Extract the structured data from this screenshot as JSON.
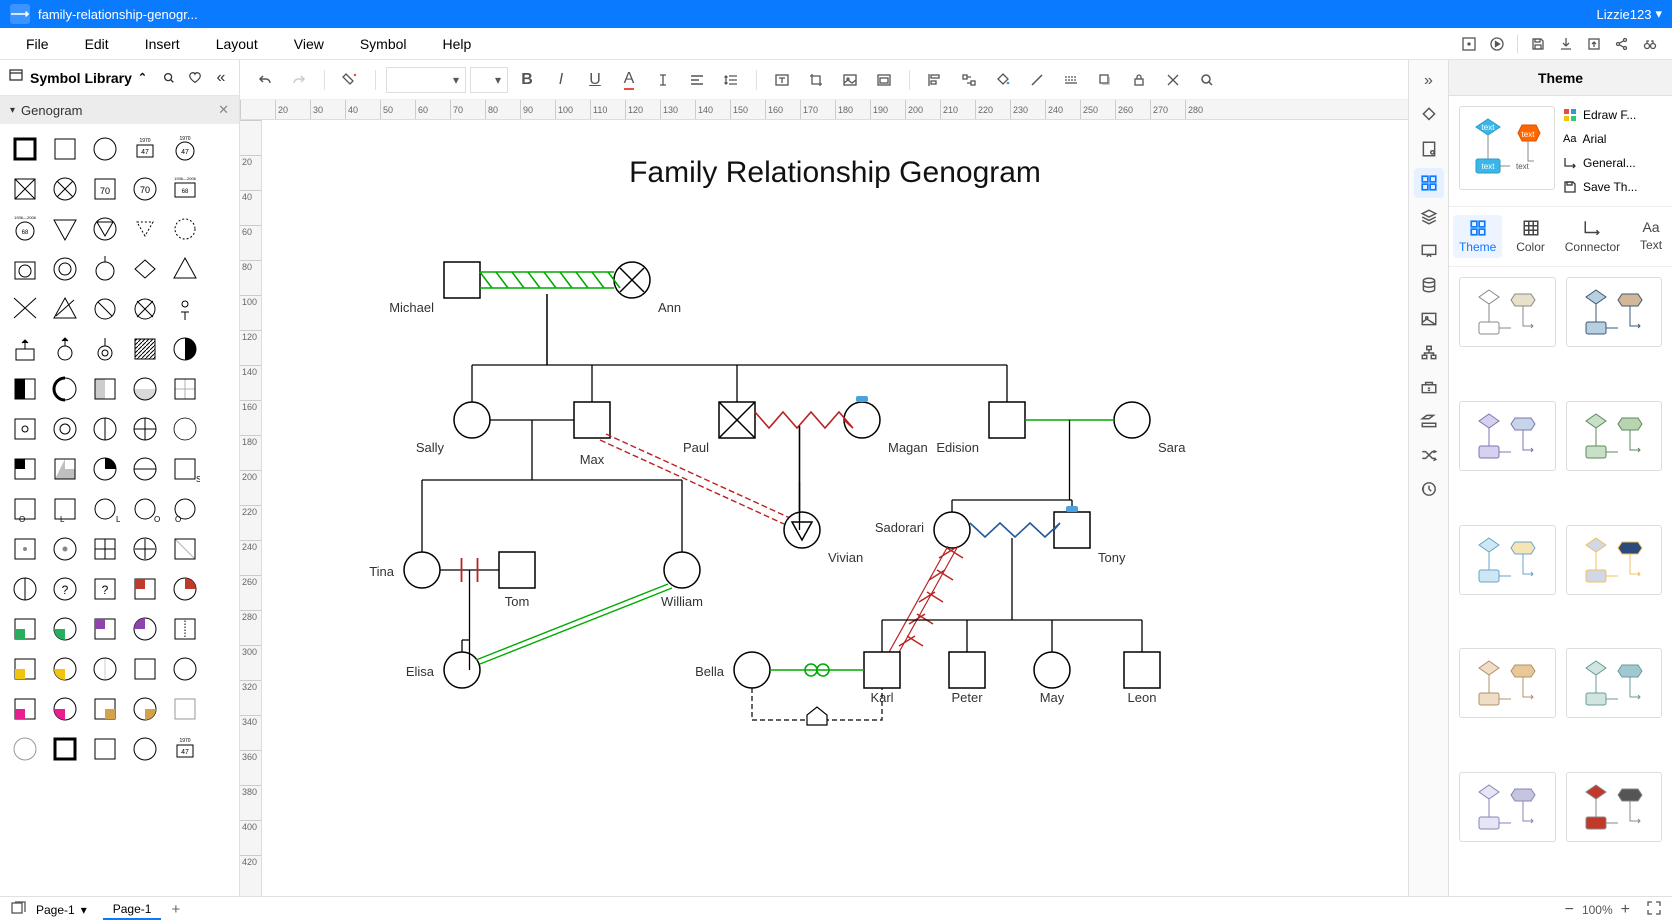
{
  "titlebar": {
    "filename": "family-relationship-genogr...",
    "user": "Lizzie123"
  },
  "menu": {
    "file": "File",
    "edit": "Edit",
    "insert": "Insert",
    "layout": "Layout",
    "view": "View",
    "symbol": "Symbol",
    "help": "Help"
  },
  "sidebar": {
    "library_title": "Symbol Library",
    "category": "Genogram"
  },
  "canvas": {
    "title": "Family Relationship Genogram",
    "people": {
      "michael": "Michael",
      "ann": "Ann",
      "sally": "Sally",
      "max": "Max",
      "paul": "Paul",
      "magan": "Magan",
      "edision": "Edision",
      "sara": "Sara",
      "tina": "Tina",
      "tom": "Tom",
      "william": "William",
      "vivian": "Vivian",
      "sadorari": "Sadorari",
      "tony": "Tony",
      "elisa": "Elisa",
      "bella": "Bella",
      "karl": "Karl",
      "peter": "Peter",
      "may": "May",
      "leon": "Leon"
    }
  },
  "right_panel": {
    "title": "Theme",
    "preview_text": {
      "top": "text",
      "mid": "text",
      "bottom_left": "text",
      "bottom_right": "text"
    },
    "options": {
      "format": "Edraw F...",
      "font": "Arial",
      "connector": "General...",
      "save": "Save Th..."
    },
    "tabs": {
      "theme": "Theme",
      "color": "Color",
      "connector": "Connector",
      "text": "Text"
    }
  },
  "footer": {
    "page_selector": "Page-1",
    "page_tab": "Page-1",
    "zoom": "100%"
  },
  "ruler": {
    "h": [
      "",
      "20",
      "30",
      "40",
      "50",
      "60",
      "70",
      "80",
      "90",
      "100",
      "110",
      "120",
      "130",
      "140",
      "150",
      "160",
      "170",
      "180",
      "190",
      "200",
      "210",
      "220",
      "230",
      "240",
      "250",
      "260",
      "270",
      "280"
    ],
    "v": [
      "",
      "20",
      "40",
      "60",
      "80",
      "100",
      "120",
      "140",
      "160",
      "180",
      "200",
      "220",
      "240",
      "260",
      "280",
      "300",
      "320",
      "340",
      "360",
      "380",
      "400",
      "420"
    ]
  }
}
